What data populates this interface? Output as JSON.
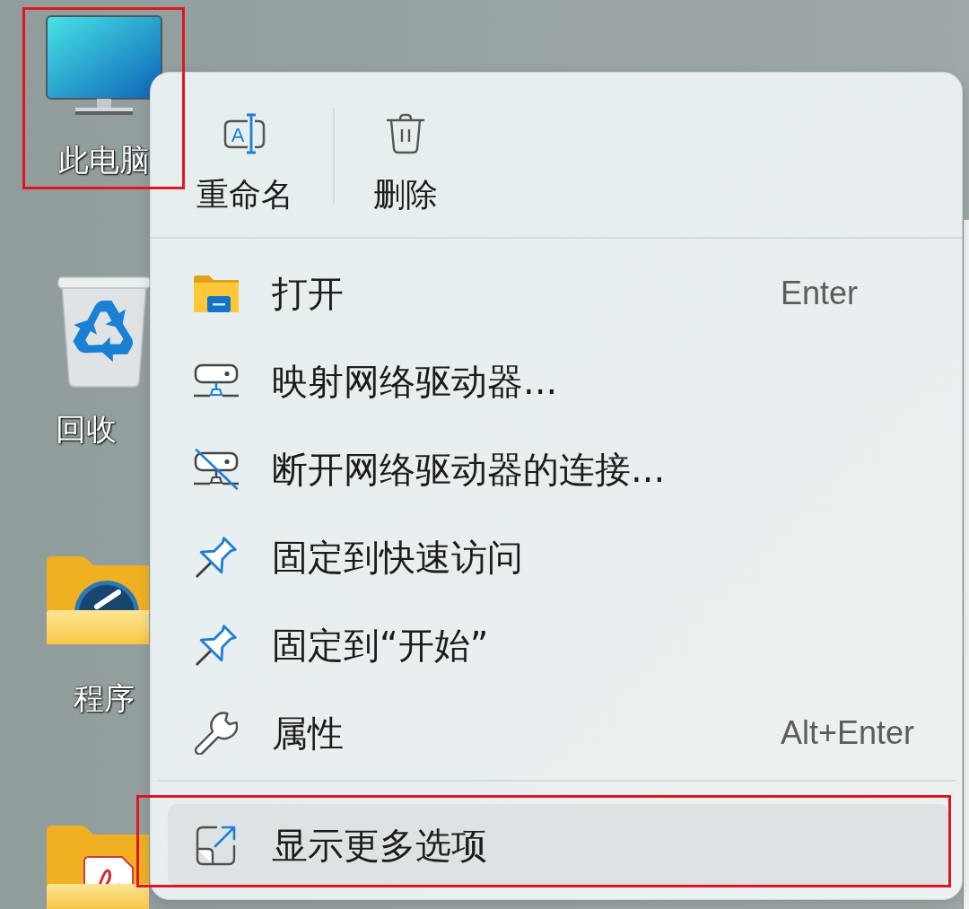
{
  "desktop": {
    "icons": [
      {
        "kind": "computer",
        "label": "此电脑",
        "highlighted": true
      },
      {
        "kind": "recycle_bin",
        "label": "回收",
        "highlighted": false
      },
      {
        "kind": "app_folder",
        "label": "程序",
        "highlighted": false
      },
      {
        "kind": "pdf_folder",
        "highlighted": false
      }
    ]
  },
  "context_menu": {
    "toolbar": [
      {
        "kind": "rename",
        "glyph": "A",
        "label": "重命名"
      },
      {
        "kind": "delete",
        "label": "删除"
      }
    ],
    "items": [
      {
        "kind": "folder",
        "label": "打开",
        "shortcut": "Enter",
        "hovered": false
      },
      {
        "kind": "map_drive",
        "label": "映射网络驱动器...",
        "hovered": false
      },
      {
        "kind": "disconnect_drive",
        "label": "断开网络驱动器的连接...",
        "hovered": false
      },
      {
        "kind": "pin",
        "label": "固定到快速访问",
        "hovered": false
      },
      {
        "kind": "pin",
        "label": "固定到“开始”",
        "hovered": false
      },
      {
        "kind": "wrench",
        "label": "属性",
        "shortcut": "Alt+Enter",
        "hovered": false
      }
    ],
    "footer_item": {
      "kind": "more_options",
      "label": "显示更多选项",
      "hovered": true,
      "highlighted": true
    }
  }
}
